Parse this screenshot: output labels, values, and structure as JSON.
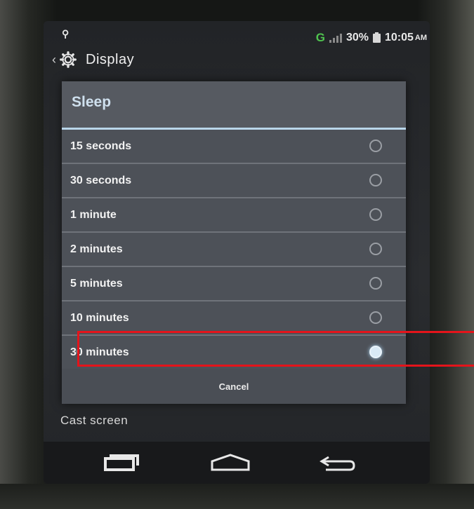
{
  "status_bar": {
    "network": "G",
    "battery_percent": "30%",
    "time": "10:05",
    "ampm": "AM"
  },
  "action_bar": {
    "title": "Display"
  },
  "dialog": {
    "title": "Sleep",
    "options": [
      {
        "label": "15 seconds",
        "selected": false
      },
      {
        "label": "30 seconds",
        "selected": false
      },
      {
        "label": "1 minute",
        "selected": false
      },
      {
        "label": "2 minutes",
        "selected": false
      },
      {
        "label": "5 minutes",
        "selected": false
      },
      {
        "label": "10 minutes",
        "selected": false
      },
      {
        "label": "30 minutes",
        "selected": true
      }
    ],
    "cancel_label": "Cancel"
  },
  "background_list": {
    "cast_screen_label": "Cast screen"
  },
  "colors": {
    "accent": "#b9d6ea",
    "highlight": "#e4141b",
    "network_green": "#4fc34f"
  }
}
